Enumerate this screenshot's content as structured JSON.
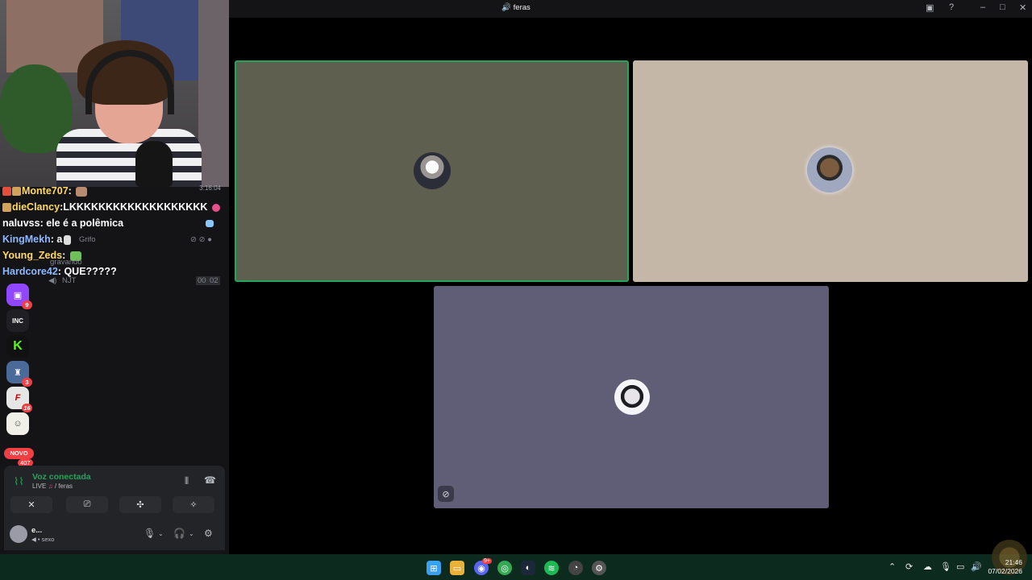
{
  "window": {
    "title": "feras"
  },
  "webcam": {
    "timestamp": "3:16:04"
  },
  "chat": [
    {
      "user": "Monte707",
      "user_color": "#ffd966",
      "message": ""
    },
    {
      "user": "dieClancy",
      "user_color": "#ffd966",
      "message": "LKKKKKKKKKKKKKKKKKKK"
    },
    {
      "user": "naluvss",
      "user_color": "#ffffff",
      "message": "ele é a polêmica"
    },
    {
      "user": "KingMekh",
      "user_color": "#8bb8ff",
      "message": "a"
    },
    {
      "user": "Young_Zeds",
      "user_color": "#ffd966",
      "message": ""
    },
    {
      "user": "Hardcore42",
      "user_color": "#8bb8ff",
      "message": "QUE?????"
    }
  ],
  "voice_ghosts": {
    "member1": "Grifo",
    "member2": "gravando",
    "member3": "NJT",
    "timer_a": "00",
    "timer_b": "02"
  },
  "servers": [
    {
      "icon": "twitch-icon",
      "color": "#9146ff",
      "glyph": "▣",
      "count": "9"
    },
    {
      "icon": "inc-server-icon",
      "color": "#1f1f24",
      "glyph": "INC",
      "count": ""
    },
    {
      "icon": "kick-icon",
      "color": "#111",
      "glyph": "K",
      "count": ""
    },
    {
      "icon": "castle-server-icon",
      "color": "#4a6a9a",
      "glyph": "♜",
      "count": "3"
    },
    {
      "icon": "f1-server-icon",
      "color": "#e6e6e6",
      "glyph": "F",
      "count": "16"
    },
    {
      "icon": "character-server-icon",
      "color": "#f0f0e8",
      "glyph": "☺",
      "count": ""
    }
  ],
  "novo": {
    "label": "NOVO",
    "count": "407"
  },
  "voice_panel": {
    "status": "Voz conectada",
    "live": "LIVE",
    "channel": "/ feras",
    "username": "e...",
    "activity": "sexo"
  },
  "taskbar": {
    "time": "21:46",
    "date": "07/02/2026",
    "discord_badge": "9+"
  },
  "colors": {
    "speaking_border": "#23a55a",
    "tile1_bg": "#5e5f4f",
    "tile2_bg": "#c5b7a7",
    "tile3_bg": "#5f5e76",
    "taskbar_bg": "#0d2a1f"
  }
}
